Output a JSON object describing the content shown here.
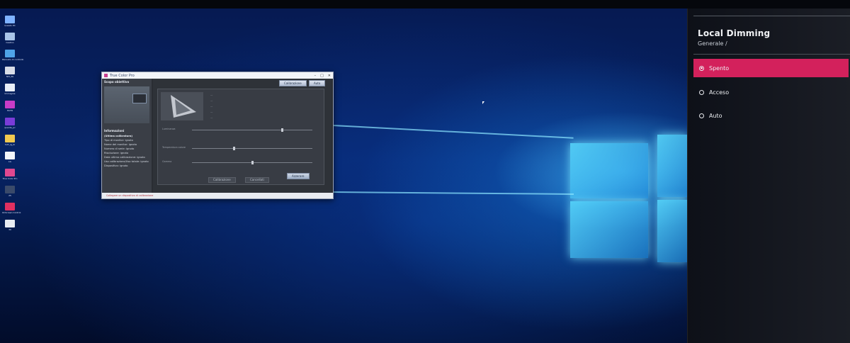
{
  "desktop": {
    "icons": [
      {
        "label": "Questo PC",
        "icon": "computer-icon",
        "color": "#7fb3ff"
      },
      {
        "label": "Cestino",
        "icon": "recycle-bin-icon",
        "color": "#a8c4e8"
      },
      {
        "label": "Pannello di controllo",
        "icon": "control-panel-icon",
        "color": "#4fa3e8"
      },
      {
        "label": "NVI_PA",
        "icon": "display-icon",
        "color": "#d8dde8"
      },
      {
        "label": "Immagine",
        "icon": "image-icon",
        "color": "#e8eef8"
      },
      {
        "label": "HCFR",
        "icon": "hcfr-icon",
        "color": "#c83cc8"
      },
      {
        "label": "quanta_pc",
        "icon": "quanta-icon",
        "color": "#7a3cd8"
      },
      {
        "label": "hcfr_lg_lk",
        "icon": "folder-icon",
        "color": "#f0c850"
      },
      {
        "label": "LG",
        "icon": "document-icon",
        "color": "#f4f6fa"
      },
      {
        "label": "True Color Pro",
        "icon": "true-color-pro-icon",
        "color": "#e04890"
      },
      {
        "label": "25",
        "icon": "monitor-icon",
        "color": "#3a4a6a"
      },
      {
        "label": "OnScreen Control",
        "icon": "onscreen-control-icon",
        "color": "#e03060"
      },
      {
        "label": "30",
        "icon": "settings-file-icon",
        "color": "#e8ecf2"
      }
    ]
  },
  "true_color_pro": {
    "title": "True Color Pro",
    "window_controls": [
      "–",
      "□",
      "✕"
    ],
    "sidebar": {
      "section_title": "Scopo obiettivo",
      "info_title": "Informazioni",
      "info_subtitle": "(Ultima calibratura)",
      "info_items": [
        "Tipo di monitor: ignoto",
        "Nome del monitor: ignoto",
        "Numero di serie: ignoto",
        "Risoluzione: ignoto",
        "Data ultima calibrazione: ignoto",
        "Uso calibrazione/Uso totale: ignoto",
        "Dispositivo: ignoto"
      ]
    },
    "buttons": {
      "calibrate": "Calibrazione",
      "auto": "Auto"
    },
    "sliders": [
      "Luminanza",
      "Temperatura colore",
      "Gamma"
    ],
    "reset_label": "Azzerare",
    "bottom_buttons": {
      "calibrate": "Calibrazione",
      "cancel": "Cancellati"
    },
    "status_text": "Collegare un dispositivo di calibrazione"
  },
  "tv_menu": {
    "title": "Local Dimming",
    "breadcrumb": "Generale  /",
    "options": [
      {
        "label": "Spento",
        "selected": true
      },
      {
        "label": "Acceso",
        "selected": false
      },
      {
        "label": "Auto",
        "selected": false
      }
    ],
    "accent_color": "#d3215c"
  }
}
